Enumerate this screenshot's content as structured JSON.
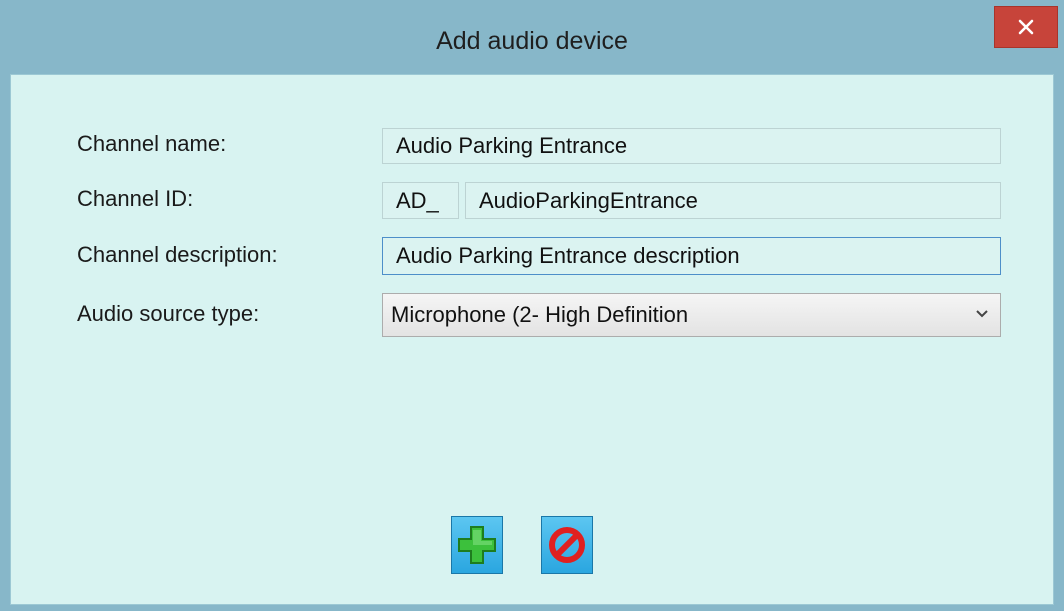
{
  "window": {
    "title": "Add audio device"
  },
  "form": {
    "channel_name": {
      "label": "Channel name:",
      "value": "Audio Parking Entrance"
    },
    "channel_id": {
      "label": "Channel ID:",
      "prefix": "AD_",
      "value": "AudioParkingEntrance"
    },
    "channel_description": {
      "label": "Channel description:",
      "value": "Audio Parking Entrance description"
    },
    "audio_source_type": {
      "label": "Audio source type:",
      "selected": "Microphone (2- High Definition"
    }
  },
  "buttons": {
    "add": {
      "icon": "green-plus-icon"
    },
    "cancel": {
      "icon": "red-prohibited-icon"
    }
  },
  "colors": {
    "title_bg": "#87b7c9",
    "client_bg": "#d8f3f1",
    "close_bg": "#c7443a",
    "button_bg": "#2aa6e0",
    "add_icon": "#3cc03c",
    "cancel_icon": "#e02020"
  }
}
